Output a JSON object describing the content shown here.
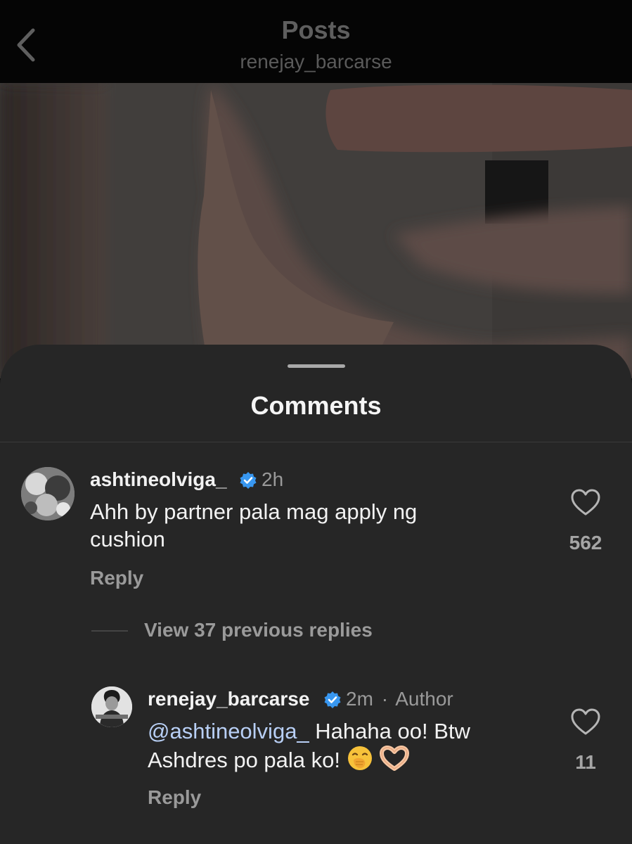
{
  "header": {
    "title": "Posts",
    "subtitle": "renejay_barcarse"
  },
  "sheet": {
    "title": "Comments"
  },
  "comments": [
    {
      "username": "ashtineolviga_",
      "verified": true,
      "time": "2h",
      "text": "Ahh by partner pala mag apply ng cushion",
      "reply_label": "Reply",
      "like_count": "562",
      "view_replies_label": "View 37 previous replies"
    }
  ],
  "replies": [
    {
      "username": "renejay_barcarse",
      "verified": true,
      "time": "2m",
      "separator": "·",
      "badge": "Author",
      "mention": "@ashtineolviga_",
      "text_line1": " Hahaha oo! Btw",
      "text_line2": "Ashdres po pala ko! ",
      "emojis": [
        "face-with-hand-over-mouth",
        "heart-hands"
      ],
      "reply_label": "Reply",
      "like_count": "11"
    }
  ],
  "colors": {
    "sheet_bg": "#262626",
    "verified_blue": "#3897f0",
    "mention": "#b8cff5"
  }
}
